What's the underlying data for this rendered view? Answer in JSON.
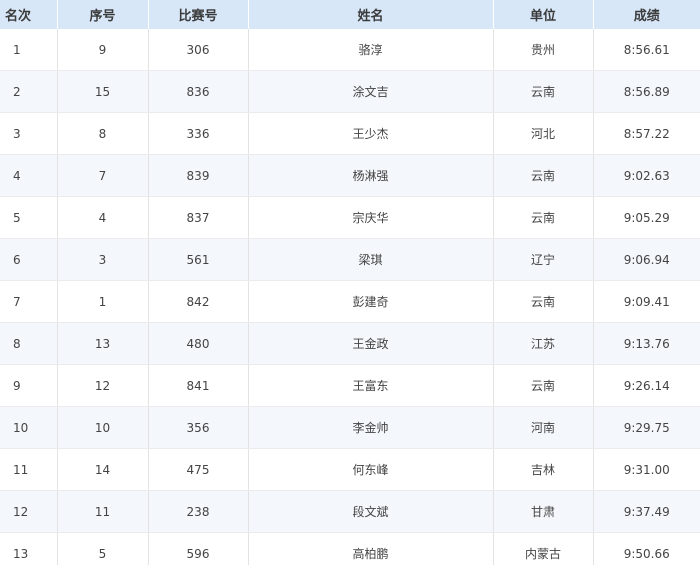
{
  "table": {
    "headers": [
      "名次",
      "序号",
      "比赛号",
      "姓名",
      "单位",
      "成绩"
    ],
    "rows": [
      [
        "1",
        "9",
        "306",
        "骆淳",
        "贵州",
        "8:56.61"
      ],
      [
        "2",
        "15",
        "836",
        "涂文吉",
        "云南",
        "8:56.89"
      ],
      [
        "3",
        "8",
        "336",
        "王少杰",
        "河北",
        "8:57.22"
      ],
      [
        "4",
        "7",
        "839",
        "杨淋强",
        "云南",
        "9:02.63"
      ],
      [
        "5",
        "4",
        "837",
        "宗庆华",
        "云南",
        "9:05.29"
      ],
      [
        "6",
        "3",
        "561",
        "梁琪",
        "辽宁",
        "9:06.94"
      ],
      [
        "7",
        "1",
        "842",
        "彭建奇",
        "云南",
        "9:09.41"
      ],
      [
        "8",
        "13",
        "480",
        "王金政",
        "江苏",
        "9:13.76"
      ],
      [
        "9",
        "12",
        "841",
        "王富东",
        "云南",
        "9:26.14"
      ],
      [
        "10",
        "10",
        "356",
        "李金帅",
        "河南",
        "9:29.75"
      ],
      [
        "11",
        "14",
        "475",
        "何东峰",
        "吉林",
        "9:31.00"
      ],
      [
        "12",
        "11",
        "238",
        "段文斌",
        "甘肃",
        "9:37.49"
      ],
      [
        "13",
        "5",
        "596",
        "高柏鹏",
        "内蒙古",
        "9:50.66"
      ]
    ]
  }
}
